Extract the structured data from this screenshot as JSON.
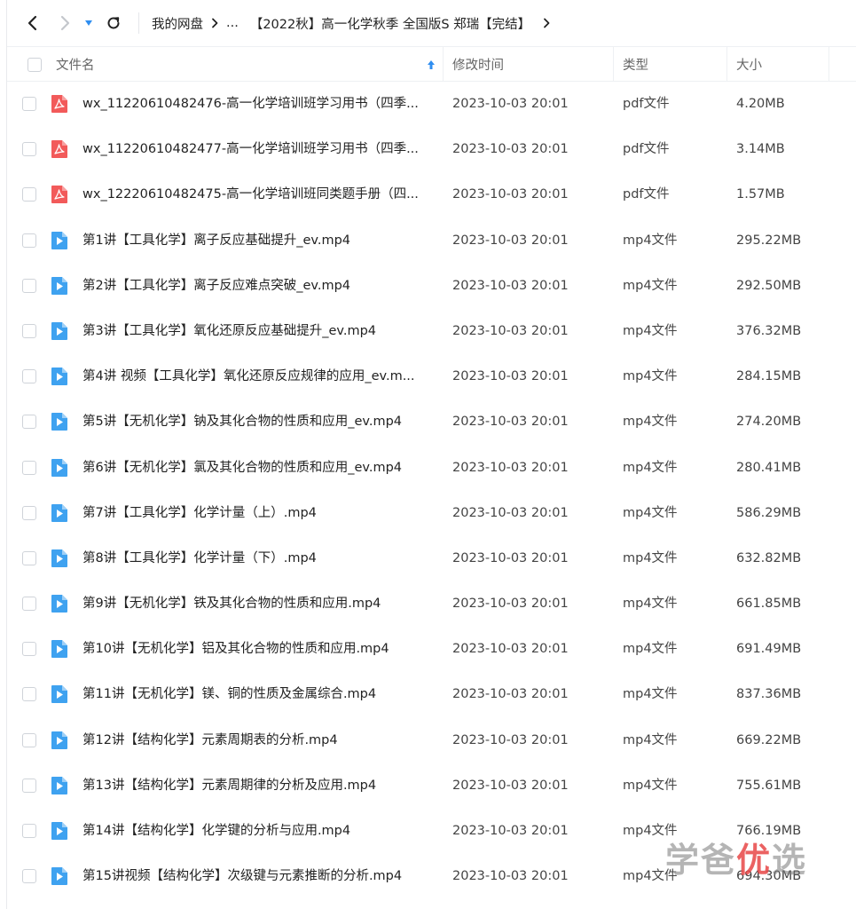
{
  "nav": {
    "breadcrumb": [
      "我的网盘",
      "...",
      "【2022秋】高一化学秋季 全国版S 郑瑞【完结】"
    ]
  },
  "table": {
    "headers": {
      "name": "文件名",
      "modified": "修改时间",
      "type": "类型",
      "size": "大小"
    }
  },
  "files": [
    {
      "icon": "pdf-file-icon",
      "name": "wx_11220610482476-高一化学培训班学习用书（四季...",
      "date": "2023-10-03 20:01",
      "type": "pdf文件",
      "size": "4.20MB"
    },
    {
      "icon": "pdf-file-icon",
      "name": "wx_11220610482477-高一化学培训班学习用书（四季...",
      "date": "2023-10-03 20:01",
      "type": "pdf文件",
      "size": "3.14MB"
    },
    {
      "icon": "pdf-file-icon",
      "name": "wx_12220610482475-高一化学培训班同类题手册（四...",
      "date": "2023-10-03 20:01",
      "type": "pdf文件",
      "size": "1.57MB"
    },
    {
      "icon": "video-file-icon",
      "name": "第1讲【工具化学】离子反应基础提升_ev.mp4",
      "date": "2023-10-03 20:01",
      "type": "mp4文件",
      "size": "295.22MB"
    },
    {
      "icon": "video-file-icon",
      "name": "第2讲【工具化学】离子反应难点突破_ev.mp4",
      "date": "2023-10-03 20:01",
      "type": "mp4文件",
      "size": "292.50MB"
    },
    {
      "icon": "video-file-icon",
      "name": "第3讲【工具化学】氧化还原反应基础提升_ev.mp4",
      "date": "2023-10-03 20:01",
      "type": "mp4文件",
      "size": "376.32MB"
    },
    {
      "icon": "video-file-icon",
      "name": "第4讲 视频【工具化学】氧化还原反应规律的应用_ev.m...",
      "date": "2023-10-03 20:01",
      "type": "mp4文件",
      "size": "284.15MB"
    },
    {
      "icon": "video-file-icon",
      "name": "第5讲【无机化学】钠及其化合物的性质和应用_ev.mp4",
      "date": "2023-10-03 20:01",
      "type": "mp4文件",
      "size": "274.20MB"
    },
    {
      "icon": "video-file-icon",
      "name": "第6讲【无机化学】氯及其化合物的性质和应用_ev.mp4",
      "date": "2023-10-03 20:01",
      "type": "mp4文件",
      "size": "280.41MB"
    },
    {
      "icon": "video-file-icon",
      "name": "第7讲【工具化学】化学计量（上）.mp4",
      "date": "2023-10-03 20:01",
      "type": "mp4文件",
      "size": "586.29MB"
    },
    {
      "icon": "video-file-icon",
      "name": "第8讲【工具化学】化学计量（下）.mp4",
      "date": "2023-10-03 20:01",
      "type": "mp4文件",
      "size": "632.82MB"
    },
    {
      "icon": "video-file-icon",
      "name": "第9讲【无机化学】铁及其化合物的性质和应用.mp4",
      "date": "2023-10-03 20:01",
      "type": "mp4文件",
      "size": "661.85MB"
    },
    {
      "icon": "video-file-icon",
      "name": "第10讲【无机化学】铝及其化合物的性质和应用.mp4",
      "date": "2023-10-03 20:01",
      "type": "mp4文件",
      "size": "691.49MB"
    },
    {
      "icon": "video-file-icon",
      "name": "第11讲【无机化学】镁、铜的性质及金属综合.mp4",
      "date": "2023-10-03 20:01",
      "type": "mp4文件",
      "size": "837.36MB"
    },
    {
      "icon": "video-file-icon",
      "name": "第12讲【结构化学】元素周期表的分析.mp4",
      "date": "2023-10-03 20:01",
      "type": "mp4文件",
      "size": "669.22MB"
    },
    {
      "icon": "video-file-icon",
      "name": "第13讲【结构化学】元素周期律的分析及应用.mp4",
      "date": "2023-10-03 20:01",
      "type": "mp4文件",
      "size": "755.61MB"
    },
    {
      "icon": "video-file-icon",
      "name": "第14讲【结构化学】化学键的分析与应用.mp4",
      "date": "2023-10-03 20:01",
      "type": "mp4文件",
      "size": "766.19MB"
    },
    {
      "icon": "video-file-icon",
      "name": "第15讲视频【结构化学】次级键与元素推断的分析.mp4",
      "date": "2023-10-03 20:01",
      "type": "mp4文件",
      "size": "694.30MB"
    }
  ],
  "watermark": {
    "part1": "学爸",
    "part2": "优",
    "part3": "选"
  },
  "colors": {
    "pdf_icon": "#f25a5a",
    "video_icon": "#3fa2f0",
    "sort_arrow": "#2f8ef0"
  }
}
